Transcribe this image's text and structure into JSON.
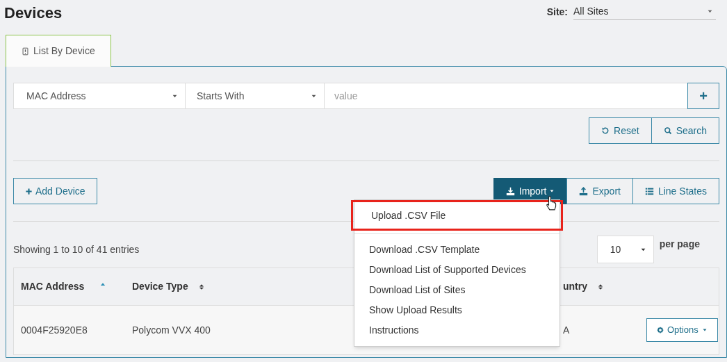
{
  "page_title": "Devices",
  "site_filter": {
    "label": "Site:",
    "value": "All Sites"
  },
  "tabs": [
    {
      "label": "List By Device",
      "selected": true
    }
  ],
  "filter": {
    "field": "MAC Address",
    "operator": "Starts With",
    "placeholder": "value",
    "add_label": "+"
  },
  "filter_buttons": [
    {
      "kind": "reset",
      "label": "Reset"
    },
    {
      "kind": "search",
      "label": "Search"
    }
  ],
  "add_button": {
    "label": "Add Device"
  },
  "toolbar": [
    {
      "kind": "import",
      "label": "Import",
      "selected": true
    },
    {
      "kind": "export",
      "label": "Export",
      "selected": false
    },
    {
      "kind": "lines",
      "label": "Line States",
      "selected": false
    }
  ],
  "import_menu": {
    "items": [
      {
        "label": "Upload .CSV File",
        "highlighted": true
      },
      {
        "label": "Download .CSV Template",
        "highlighted": false
      },
      {
        "label": "Download List of Supported Devices",
        "highlighted": false
      },
      {
        "label": "Download List of Sites",
        "highlighted": false
      },
      {
        "label": "Show Upload Results",
        "highlighted": false
      },
      {
        "label": "Instructions",
        "highlighted": false
      }
    ]
  },
  "summary": "Showing 1 to 10 of 41 entries",
  "page_size": {
    "value": "10",
    "label": "per page"
  },
  "table": {
    "columns": [
      {
        "label": "MAC Address",
        "sorted": true
      },
      {
        "label": "Device Type",
        "sorted": false
      },
      {
        "label": "untry",
        "sorted": false
      }
    ],
    "rows": [
      {
        "cells": [
          "0004F25920E8",
          "Polycom VVX 400",
          "A"
        ],
        "action": "Options"
      }
    ]
  }
}
